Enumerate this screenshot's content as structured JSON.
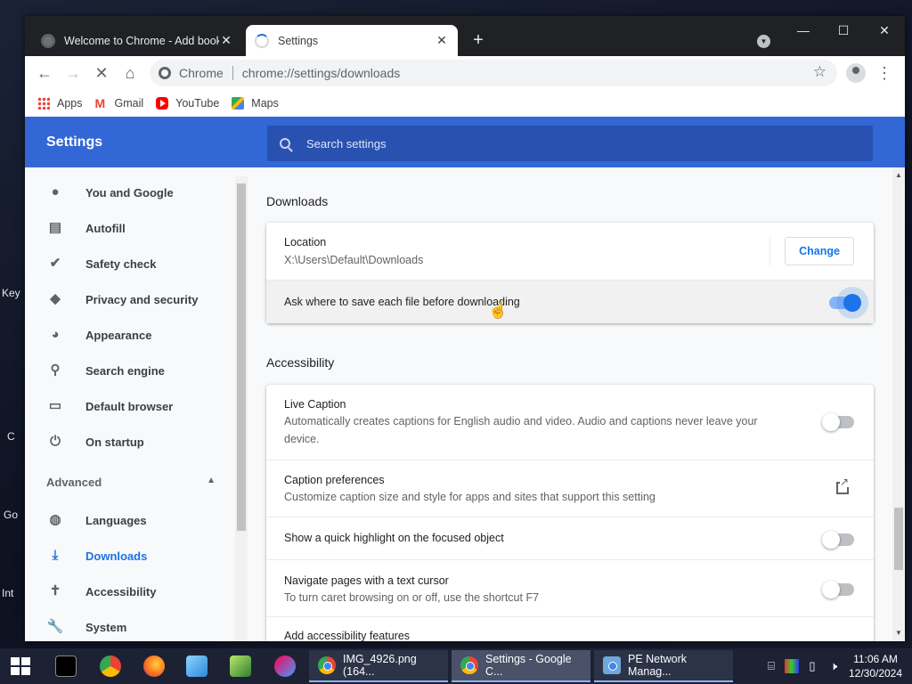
{
  "desktop": {
    "labels": [
      "Key",
      "C",
      "Go",
      "Int"
    ]
  },
  "browser": {
    "tabs": [
      {
        "title": "Welcome to Chrome - Add book",
        "active": false
      },
      {
        "title": "Settings",
        "active": true
      }
    ],
    "new_tab": "+",
    "window_controls": {
      "minimize": "—",
      "maximize": "☐",
      "close": "✕"
    },
    "omnibox": {
      "origin": "Chrome",
      "url": "chrome://settings/downloads"
    },
    "bookmarks": [
      {
        "label": "Apps",
        "icon": "apps-grid-icon"
      },
      {
        "label": "Gmail",
        "icon": "gmail-icon"
      },
      {
        "label": "YouTube",
        "icon": "youtube-icon"
      },
      {
        "label": "Maps",
        "icon": "maps-icon"
      }
    ]
  },
  "settings": {
    "title": "Settings",
    "search_placeholder": "Search settings",
    "nav": [
      {
        "label": "You and Google",
        "icon": "person-icon",
        "selected": false
      },
      {
        "label": "Autofill",
        "icon": "clipboard-icon",
        "selected": false
      },
      {
        "label": "Safety check",
        "icon": "shield-check-icon",
        "selected": false
      },
      {
        "label": "Privacy and security",
        "icon": "shield-icon",
        "selected": false
      },
      {
        "label": "Appearance",
        "icon": "palette-icon",
        "selected": false
      },
      {
        "label": "Search engine",
        "icon": "search-icon",
        "selected": false
      },
      {
        "label": "Default browser",
        "icon": "browser-icon",
        "selected": false
      },
      {
        "label": "On startup",
        "icon": "power-icon",
        "selected": false
      }
    ],
    "advanced_label": "Advanced",
    "advanced_nav": [
      {
        "label": "Languages",
        "icon": "globe-icon",
        "selected": false
      },
      {
        "label": "Downloads",
        "icon": "download-icon",
        "selected": true
      },
      {
        "label": "Accessibility",
        "icon": "accessibility-icon",
        "selected": false
      },
      {
        "label": "System",
        "icon": "wrench-icon",
        "selected": false
      }
    ],
    "downloads": {
      "heading": "Downloads",
      "location_label": "Location",
      "location_value": "X:\\Users\\Default\\Downloads",
      "change_button": "Change",
      "ask_where_label": "Ask where to save each file before downloading",
      "ask_where_enabled": true
    },
    "accessibility": {
      "heading": "Accessibility",
      "live_caption_label": "Live Caption",
      "live_caption_desc_line1": "Automatically creates captions for English audio and video. Audio and captions never leave your",
      "live_caption_desc_line2": "device.",
      "live_caption_enabled": false,
      "caption_prefs_label": "Caption preferences",
      "caption_prefs_desc": "Customize caption size and style for apps and sites that support this setting",
      "highlight_label": "Show a quick highlight on the focused object",
      "highlight_enabled": false,
      "caret_label": "Navigate pages with a text cursor",
      "caret_desc": "To turn caret browsing on or off, use the shortcut F7",
      "caret_enabled": false,
      "add_features_label": "Add accessibility features"
    }
  },
  "taskbar": {
    "apps": [
      {
        "label": "IMG_4926.png (164..."
      },
      {
        "label": "Settings - Google C..."
      },
      {
        "label": "PE Network Manag..."
      }
    ],
    "clock_time": "11:06 AM",
    "clock_date": "12/30/2024"
  },
  "colors": {
    "accent": "#1a73e8",
    "header": "#3367d6",
    "tab_strip": "#202124"
  }
}
